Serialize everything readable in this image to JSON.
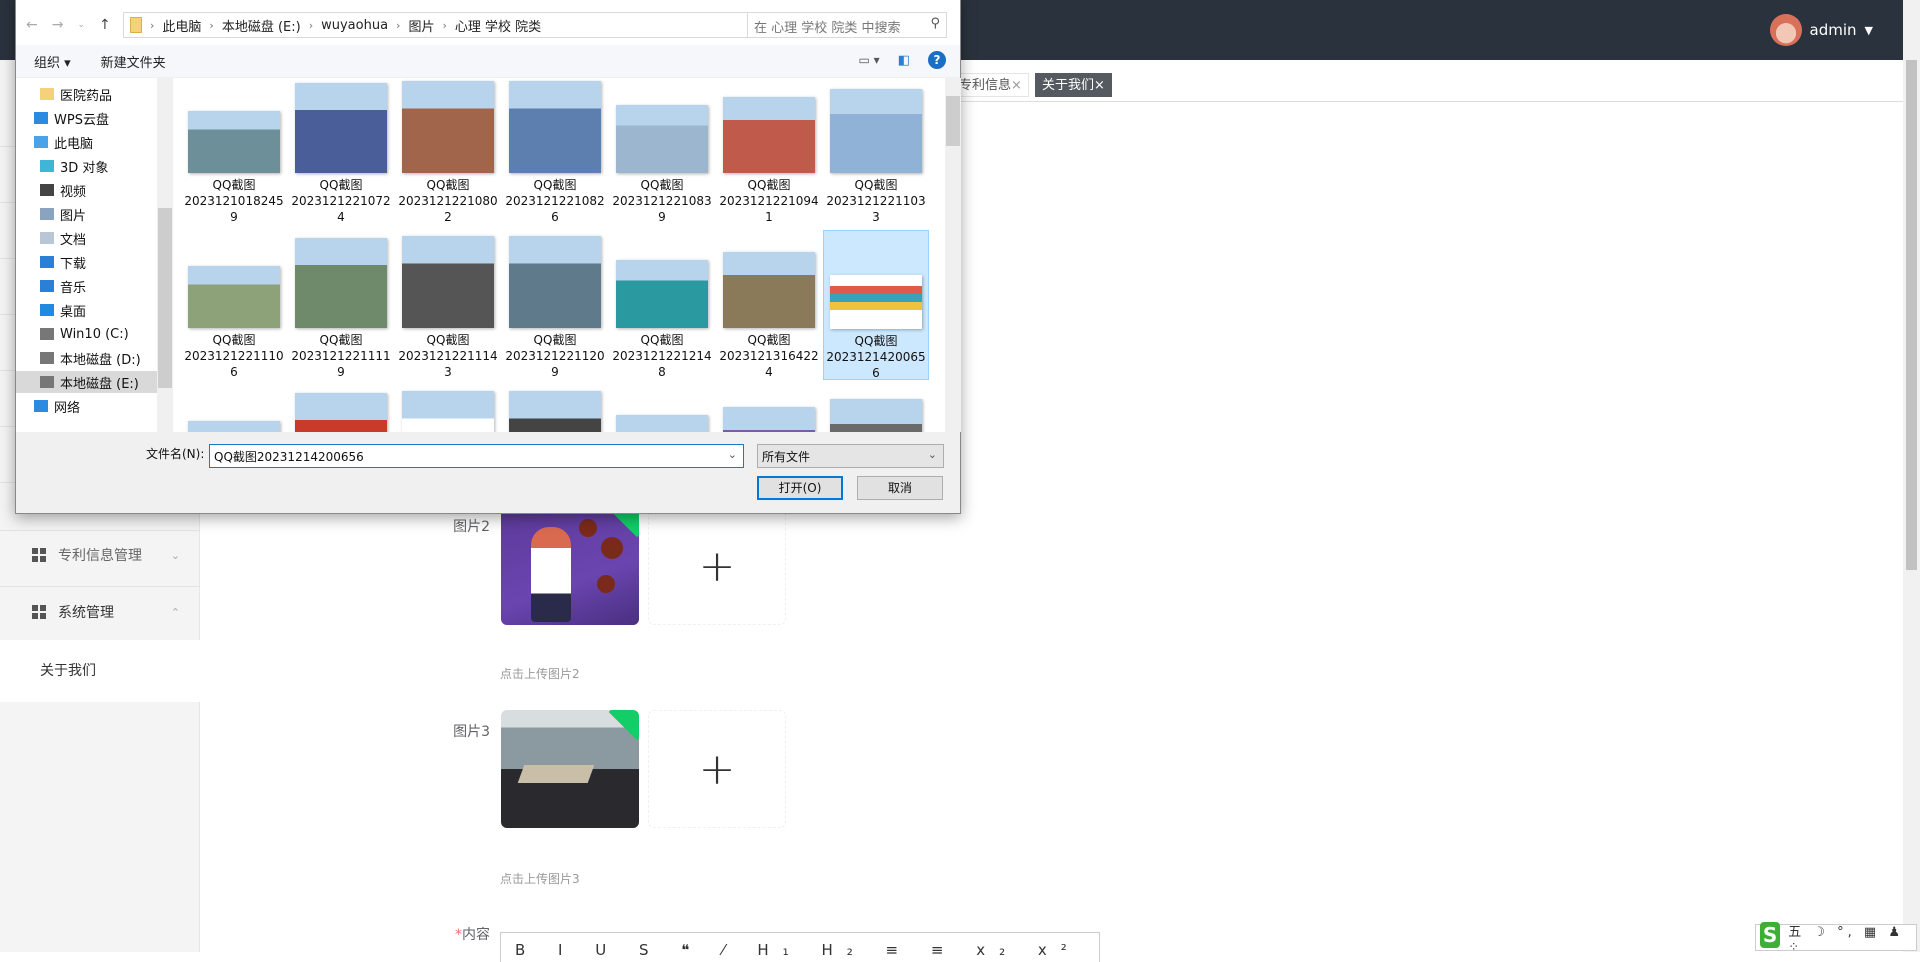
{
  "header": {
    "username": "admin",
    "dropdown_icon": "caret-down-icon"
  },
  "tabs": [
    {
      "label": "专利信息",
      "close": "×"
    },
    {
      "label": "关于我们",
      "close": "×",
      "active": true
    }
  ],
  "sidebar": {
    "items": [
      {
        "label": "专利信息管理",
        "icon": "grid-icon",
        "chevron": "⌄"
      },
      {
        "label": "系统管理",
        "icon": "grid-icon",
        "chevron": "⌃"
      }
    ],
    "sub_item": "关于我们"
  },
  "form": {
    "image2_label": "图片2",
    "image2_hint": "点击上传图片2",
    "image3_label": "图片3",
    "image3_hint": "点击上传图片3",
    "content_label": "内容",
    "required_mark": "*",
    "editor_toolbar": "B I U S ❝ ⁄ H₁ H₂ ≡ ≡ x₂ x² ≡ ≡",
    "plus": "+"
  },
  "ime": {
    "logo": "S",
    "items": "五 ☽ °, ▦ ♟ ⁘"
  },
  "dialog": {
    "breadcrumb": [
      "此电脑",
      "本地磁盘 (E:)",
      "wuyaohua",
      "图片",
      "心理 学校 院类"
    ],
    "search_placeholder": "在 心理 学校 院类 中搜索",
    "organize": "组织 ▾",
    "new_folder": "新建文件夹",
    "nav": [
      {
        "label": "医院药品",
        "icon": "folder-icon",
        "indent": 2,
        "color": "#f3d27a"
      },
      {
        "label": "WPS云盘",
        "icon": "cloud-icon",
        "indent": 1,
        "color": "#2a8be0"
      },
      {
        "label": "此电脑",
        "icon": "computer-icon",
        "indent": 1,
        "color": "#4aa3e8"
      },
      {
        "label": "3D 对象",
        "icon": "cube-icon",
        "indent": 2,
        "color": "#3fb6d8"
      },
      {
        "label": "视频",
        "icon": "video-icon",
        "indent": 2,
        "color": "#444"
      },
      {
        "label": "图片",
        "icon": "picture-icon",
        "indent": 2,
        "color": "#8aa4c0"
      },
      {
        "label": "文档",
        "icon": "document-icon",
        "indent": 2,
        "color": "#b8c6d6"
      },
      {
        "label": "下载",
        "icon": "download-icon",
        "indent": 2,
        "color": "#2a7fd6"
      },
      {
        "label": "音乐",
        "icon": "music-icon",
        "indent": 2,
        "color": "#2a7fd6"
      },
      {
        "label": "桌面",
        "icon": "desktop-icon",
        "indent": 2,
        "color": "#1f8ae0"
      },
      {
        "label": "Win10 (C:)",
        "icon": "drive-icon",
        "indent": 2,
        "color": "#777"
      },
      {
        "label": "本地磁盘 (D:)",
        "icon": "drive-icon",
        "indent": 2,
        "color": "#777"
      },
      {
        "label": "本地磁盘 (E:)",
        "icon": "drive-icon",
        "indent": 2,
        "color": "#777",
        "selected": true
      },
      {
        "label": "网络",
        "icon": "network-icon",
        "indent": 1,
        "color": "#2a8be0"
      }
    ],
    "files": [
      {
        "name": "QQ截图",
        "num": "2023121018245",
        "tail": "9",
        "color": "#6d8f9a"
      },
      {
        "name": "QQ截图",
        "num": "2023121221072",
        "tail": "4",
        "color": "#4a5f9a"
      },
      {
        "name": "QQ截图",
        "num": "2023121221080",
        "tail": "2",
        "color": "#a0654a"
      },
      {
        "name": "QQ截图",
        "num": "2023121221082",
        "tail": "6",
        "color": "#5d7fb0"
      },
      {
        "name": "QQ截图",
        "num": "2023121221083",
        "tail": "9",
        "color": "#9db6cf"
      },
      {
        "name": "QQ截图",
        "num": "2023121221094",
        "tail": "1",
        "color": "#c05a4a"
      },
      {
        "name": "QQ截图",
        "num": "2023121221103",
        "tail": "3",
        "color": "#8fb2d6"
      },
      {
        "name": "QQ截图",
        "num": "2023121221110",
        "tail": "6",
        "color": "#8ea27a"
      },
      {
        "name": "QQ截图",
        "num": "2023121221111",
        "tail": "9",
        "color": "#6e8a6a"
      },
      {
        "name": "QQ截图",
        "num": "2023121221114",
        "tail": "3",
        "color": "#555"
      },
      {
        "name": "QQ截图",
        "num": "2023121221120",
        "tail": "9",
        "color": "#5f7a8a"
      },
      {
        "name": "QQ截图",
        "num": "2023121221214",
        "tail": "8",
        "color": "#2a9aa0"
      },
      {
        "name": "QQ截图",
        "num": "2023121316422",
        "tail": "4",
        "color": "#8a7a5a"
      },
      {
        "name": "QQ截图",
        "num": "2023121420065",
        "tail": "6",
        "color": "#e9dfc8",
        "selected": true
      },
      {
        "name": "",
        "num": "",
        "tail": "",
        "color": "#e0503a"
      },
      {
        "name": "",
        "num": "",
        "tail": "",
        "color": "#c83a2a"
      },
      {
        "name": "",
        "num": "",
        "tail": "",
        "color": "#ffffff"
      },
      {
        "name": "",
        "num": "",
        "tail": "",
        "color": "#444"
      },
      {
        "name": "",
        "num": "",
        "tail": "",
        "color": "#d8b0a8"
      },
      {
        "name": "",
        "num": "",
        "tail": "",
        "color": "#7a5ab0"
      },
      {
        "name": "",
        "num": "",
        "tail": "",
        "color": "#6a6a6a"
      }
    ],
    "filename_label": "文件名(N):",
    "filename_value": "QQ截图20231214200656",
    "filetype": "所有文件",
    "open": "打开(O)",
    "cancel": "取消"
  }
}
